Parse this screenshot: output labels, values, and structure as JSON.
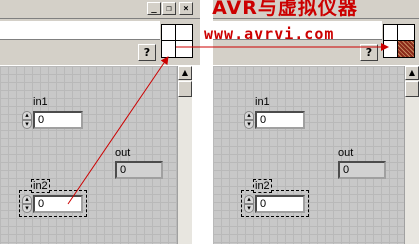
{
  "watermark": {
    "title": "AVR与虚拟仪器",
    "url": "www.avrvi.com"
  },
  "window_controls": {
    "minimize": "_",
    "restore": "❐",
    "close": "×"
  },
  "toolbar": {
    "help_label": "?"
  },
  "left_panel": {
    "in1": {
      "label": "in1",
      "value": "0"
    },
    "in2": {
      "label": "in2",
      "value": "0"
    },
    "out": {
      "label": "out",
      "value": "0"
    }
  },
  "right_panel": {
    "in1": {
      "label": "in1",
      "value": "0"
    },
    "in2": {
      "label": "in2",
      "value": "0"
    },
    "out": {
      "label": "out",
      "value": "0"
    }
  },
  "colors": {
    "annotation_red": "#cc0000",
    "panel_bg": "#c8c8c8",
    "connector_fill": "#8b2a1a"
  }
}
